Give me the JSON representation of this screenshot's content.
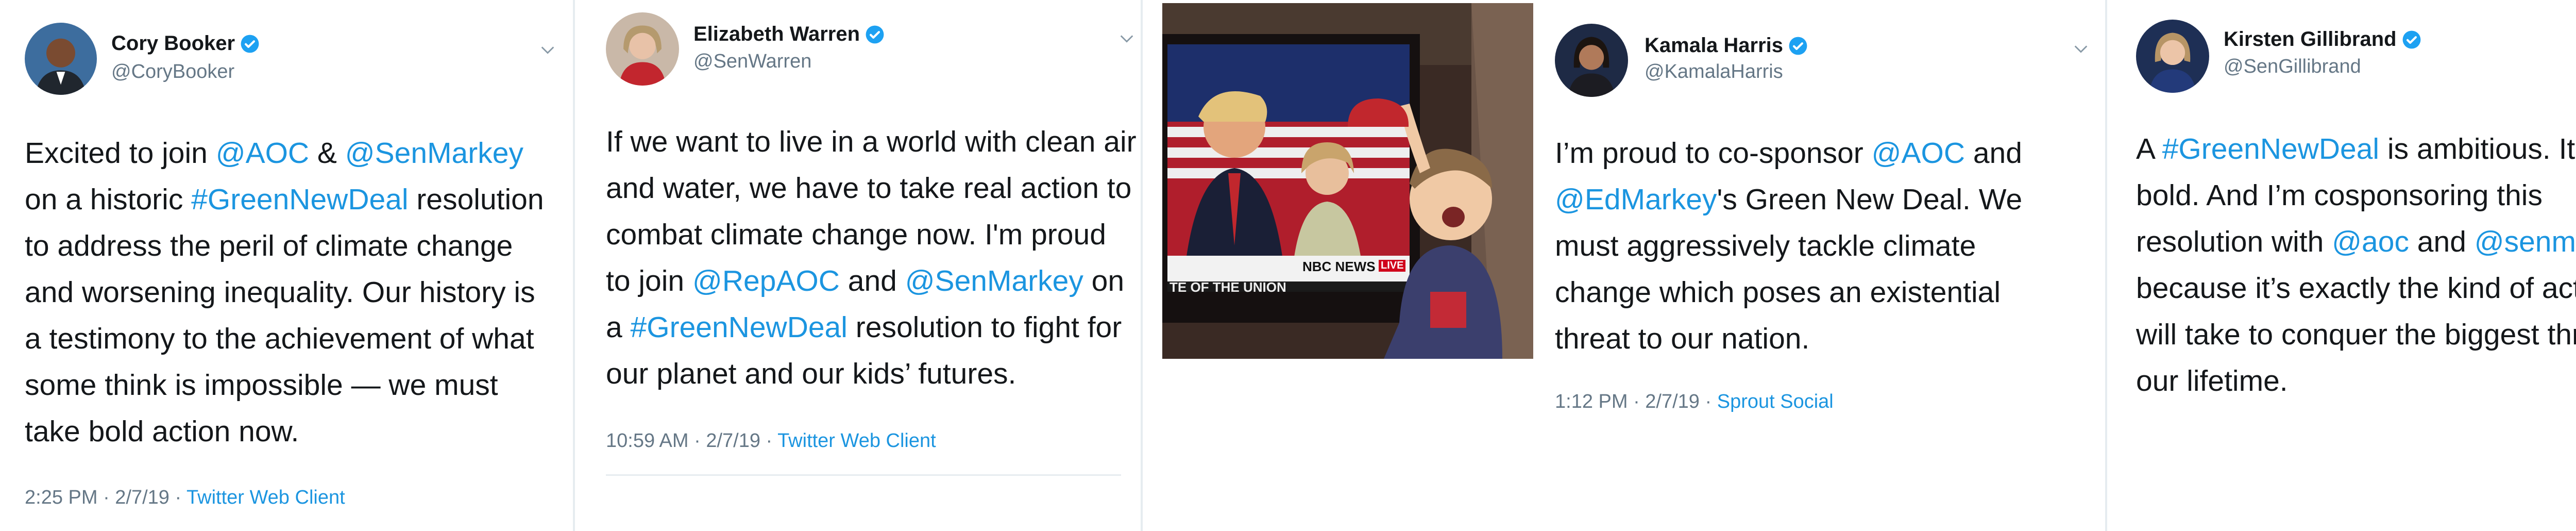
{
  "tweets": [
    {
      "name": "Cory Booker",
      "handle": "@CoryBooker",
      "lines": [
        [
          {
            "t": "Excited to join "
          },
          {
            "t": "@AOC",
            "l": true
          },
          {
            "t": " & "
          },
          {
            "t": "@SenMarkey",
            "l": true
          }
        ],
        [
          {
            "t": "on a historic "
          },
          {
            "t": "#GreenNewDeal",
            "l": true
          },
          {
            "t": " resolution"
          }
        ],
        [
          {
            "t": "to address the peril of climate change"
          }
        ],
        [
          {
            "t": "and worsening inequality. Our history is"
          }
        ],
        [
          {
            "t": "a testimony to the achievement of what"
          }
        ],
        [
          {
            "t": "some think is impossible — we must"
          }
        ],
        [
          {
            "t": "take bold action now."
          }
        ]
      ],
      "time": "2:25 PM · 2/7/19 · ",
      "source": "Twitter Web Client"
    },
    {
      "name": "Elizabeth Warren",
      "handle": "@SenWarren",
      "lines": [
        [
          {
            "t": "If we want to live in a world with clean air"
          }
        ],
        [
          {
            "t": "and water, we have to take real action to"
          }
        ],
        [
          {
            "t": "combat climate change now. I'm proud"
          }
        ],
        [
          {
            "t": "to join "
          },
          {
            "t": "@RepAOC",
            "l": true
          },
          {
            "t": " and "
          },
          {
            "t": "@SenMarkey",
            "l": true
          },
          {
            "t": " on"
          }
        ],
        [
          {
            "t": "a "
          },
          {
            "t": "#GreenNewDeal",
            "l": true
          },
          {
            "t": " resolution to fight for"
          }
        ],
        [
          {
            "t": "our planet and our kids’ futures."
          }
        ]
      ],
      "time": "10:59 AM · 2/7/19 · ",
      "source": "Twitter Web Client"
    },
    {
      "name": "Kamala Harris",
      "handle": "@KamalaHarris",
      "lines": [
        [
          {
            "t": "I’m proud to co-sponsor "
          },
          {
            "t": "@AOC",
            "l": true
          },
          {
            "t": " and"
          }
        ],
        [
          {
            "t": "@EdMarkey",
            "l": true
          },
          {
            "t": "'s Green New Deal. We"
          }
        ],
        [
          {
            "t": "must aggressively tackle climate"
          }
        ],
        [
          {
            "t": "change which poses an existential"
          }
        ],
        [
          {
            "t": "threat to our nation."
          }
        ]
      ],
      "time": "1:12 PM · 2/7/19 · ",
      "source": "Sprout Social"
    },
    {
      "name": "Kirsten Gillibrand",
      "handle": "@SenGillibrand",
      "lines": [
        [
          {
            "t": "A "
          },
          {
            "t": "#GreenNewDeal",
            "l": true
          },
          {
            "t": " is ambitious. It's"
          }
        ],
        [
          {
            "t": "bold. And I’m cosponsoring this"
          }
        ],
        [
          {
            "t": "resolution with "
          },
          {
            "t": "@aoc",
            "l": true
          },
          {
            "t": " and "
          },
          {
            "t": "@senmarkey",
            "l": true
          }
        ],
        [
          {
            "t": "because it’s exactly the kind of action it"
          }
        ],
        [
          {
            "t": "will take to conquer the biggest threat of"
          }
        ],
        [
          {
            "t": "our lifetime."
          }
        ]
      ],
      "time": "",
      "source": ""
    }
  ],
  "photo": {
    "tv_logo": "NBC NEWS",
    "tv_live": "LIVE",
    "tv_ticker": "TE OF THE UNION"
  },
  "colors": {
    "link": "#1b95e0",
    "verified": "#1da1f2",
    "meta": "#657786"
  }
}
